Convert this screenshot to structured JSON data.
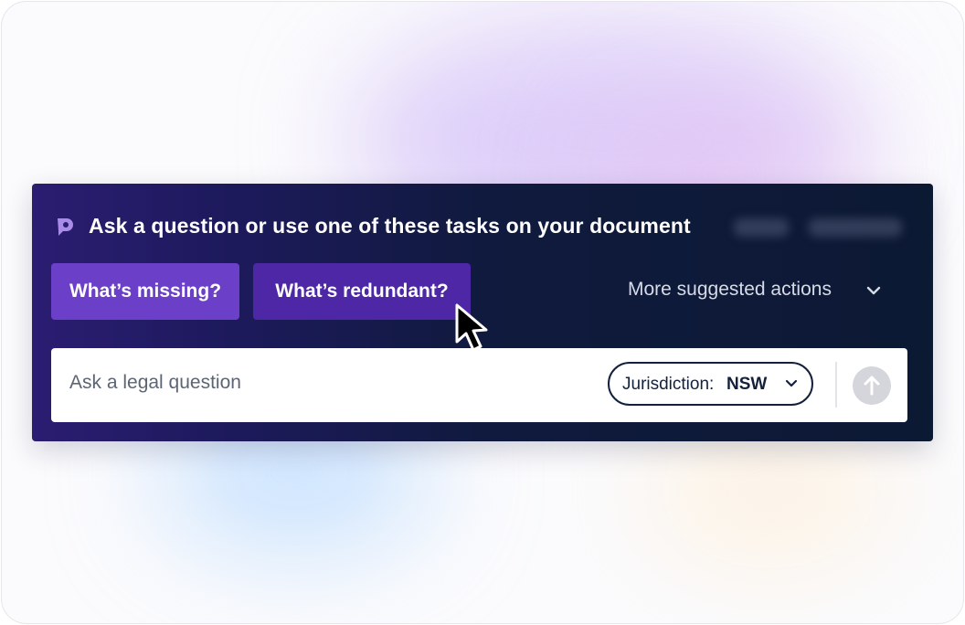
{
  "header": {
    "logo_icon": "p-logo-icon",
    "title": "Ask a question or use one of these tasks on your document"
  },
  "tasks": {
    "missing_label": "What’s missing?",
    "redundant_label": "What’s redundant?",
    "more_label": "More suggested actions",
    "more_icon": "chevron-down-icon"
  },
  "input": {
    "placeholder": "Ask a legal question",
    "value": ""
  },
  "jurisdiction": {
    "label": "Jurisdiction:",
    "value": "NSW",
    "icon": "chevron-down-icon"
  },
  "send": {
    "icon": "arrow-up-icon"
  },
  "colors": {
    "panel_start": "#2b1d72",
    "panel_end": "#0c1933",
    "button_primary": "#6c3fc8",
    "button_secondary": "#4d27a6",
    "send_disabled": "#d4d6db"
  }
}
